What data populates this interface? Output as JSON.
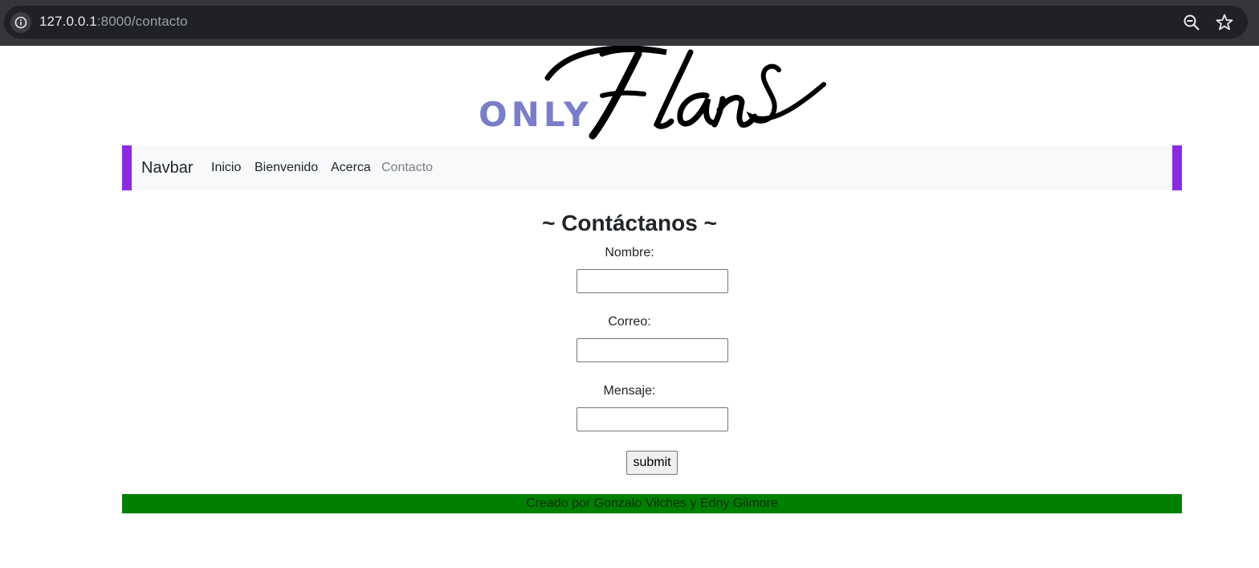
{
  "browser": {
    "url_host": "127.0.0.1",
    "url_path": ":8000/contacto",
    "icons": [
      "info-icon",
      "zoom-out-icon",
      "bookmark-star-icon"
    ]
  },
  "logo": {
    "small_text": "ONLY",
    "script_text": "Flans",
    "small_color": "#7a7dc8"
  },
  "navbar": {
    "brand": "Navbar",
    "links": [
      "Inicio",
      "Bienvenido",
      "Acerca",
      "Contacto"
    ],
    "active": "Contacto",
    "accent_color": "#8a2be2"
  },
  "form": {
    "title": "~ Contáctanos ~",
    "fields": [
      {
        "label": "Nombre:",
        "value": ""
      },
      {
        "label": "Correo:",
        "value": ""
      },
      {
        "label": "Mensaje:",
        "value": ""
      }
    ],
    "submit_label": "submit"
  },
  "footer": {
    "text": "Creado por Gonzalo Vilches y Edny Gilmore",
    "background": "#008000"
  }
}
